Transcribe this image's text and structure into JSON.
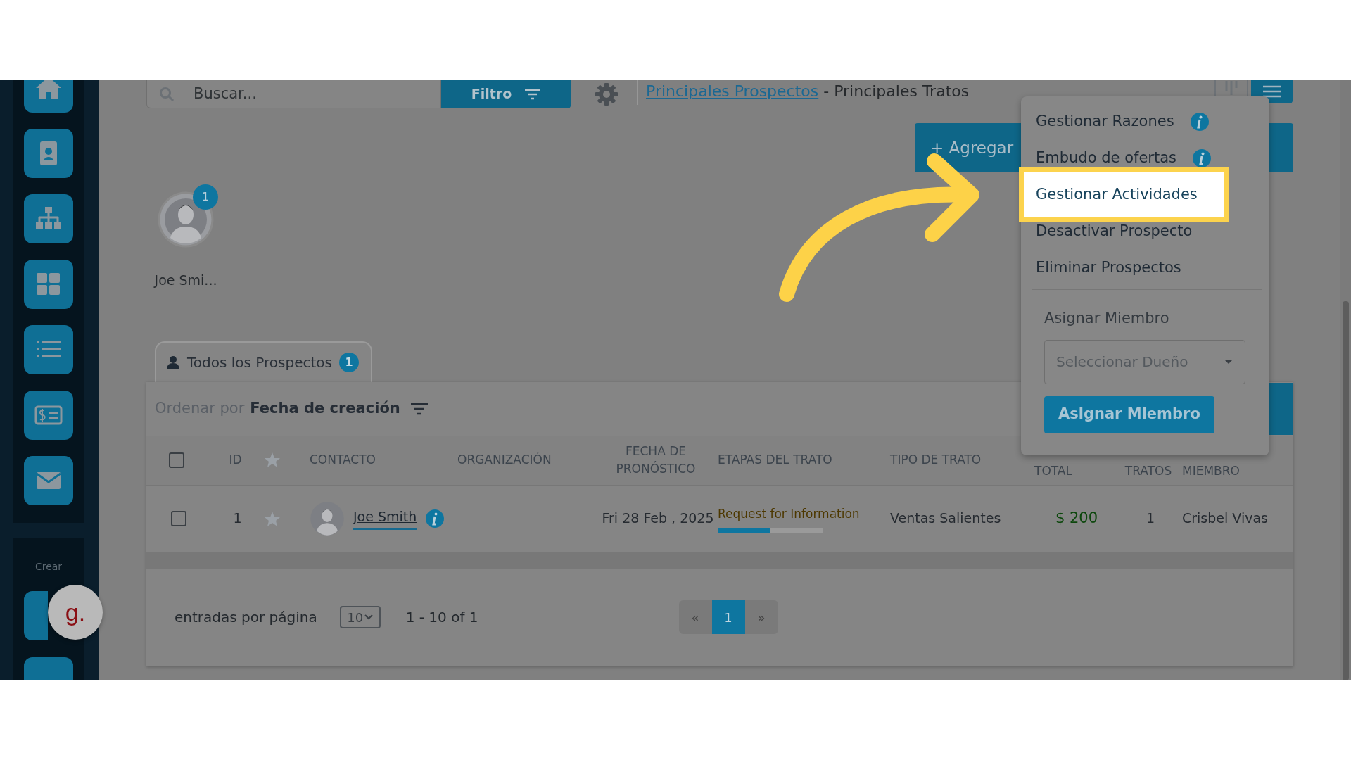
{
  "sidebar": {
    "create_label": "Crear"
  },
  "widget": {
    "label": "g."
  },
  "search": {
    "placeholder": "Buscar..."
  },
  "filter_button": "Filtro",
  "breadcrumb": {
    "link": "Principales Prospectos",
    "separator": " - ",
    "current": "Principales Tratos"
  },
  "add_button": "+ Agregar",
  "owners": [
    {
      "name": "Joe Smi...",
      "badge": "1"
    }
  ],
  "tabs": [
    {
      "label": "Todos los Prospectos",
      "count": "1",
      "selected": true
    }
  ],
  "sort": {
    "label": "Ordenar por",
    "value": "Fecha de creación"
  },
  "table": {
    "header_checked": false,
    "columns": [
      "ID",
      "CONTACTO",
      "ORGANIZACIÓN",
      "FECHA DE PRONÓSTICO",
      "ETAPAS DEL TRATO",
      "TIPO DE TRATO",
      "TOTAL",
      "TRATOS",
      "MIEMBRO"
    ],
    "rows": [
      {
        "checked": false,
        "id": "1",
        "starred": false,
        "contact": "Joe Smith",
        "forecast_date": "Fri 28 Feb , 2025",
        "stage": "Request for Information",
        "progress": {
          "level": 0.5
        },
        "deal_type": "Ventas Salientes",
        "total": "$ 200",
        "deals": "1",
        "member": "Crisbel Vivas"
      }
    ]
  },
  "pagination": {
    "per_page_label": "entradas por página",
    "per_page": "10",
    "range": "1 - 10 of 1",
    "prev": "«",
    "next": "»",
    "pages": [
      {
        "label": "1",
        "selected": true
      }
    ]
  },
  "menu": {
    "items": [
      {
        "label": "Gestionar Razones",
        "info": true,
        "highlighted": false
      },
      {
        "label": "Embudo de ofertas",
        "info": true,
        "highlighted": false
      },
      {
        "label": "Gestionar Actividades",
        "info": false,
        "highlighted": true
      },
      {
        "label": "Desactivar Prospecto",
        "info": false,
        "highlighted": false
      },
      {
        "label": "Eliminar Prospectos",
        "info": false,
        "highlighted": false
      }
    ],
    "assign_label": "Asignar Miembro",
    "owner_select": {
      "placeholder": "Seleccionar Dueño"
    },
    "assign_button": "Asignar Miembro"
  }
}
